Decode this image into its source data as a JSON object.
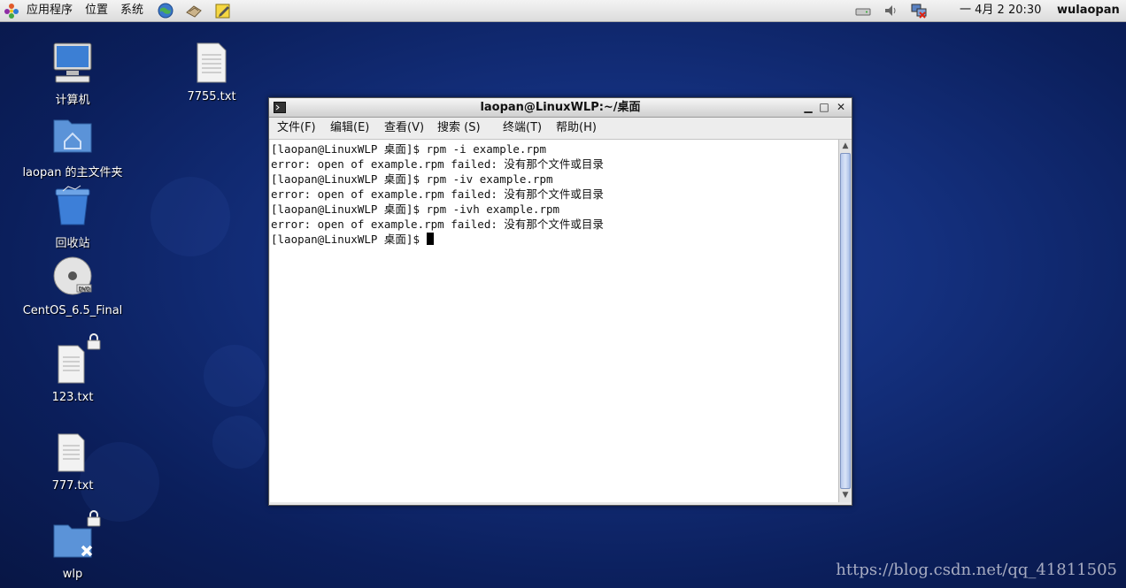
{
  "top_panel": {
    "menu": [
      "应用程序",
      "位置",
      "系统"
    ],
    "clock": "一 4月  2 20:30",
    "user": "wulaopan"
  },
  "desktop": {
    "icons": [
      {
        "label": "计算机",
        "icon": "computer-icon"
      },
      {
        "label": "7755.txt",
        "icon": "text-file-icon"
      },
      {
        "label": "laopan 的主文件夹",
        "icon": "home-folder-icon"
      },
      {
        "label": "回收站",
        "icon": "trash-icon"
      },
      {
        "label": "CentOS_6.5_Final",
        "icon": "dvd-icon"
      },
      {
        "label": "123.txt",
        "icon": "locked-text-file-icon"
      },
      {
        "label": "777.txt",
        "icon": "text-file-icon"
      },
      {
        "label": "wlp",
        "icon": "locked-folder-icon"
      }
    ]
  },
  "terminal": {
    "title": "laopan@LinuxWLP:~/桌面",
    "menu": [
      "文件(F)",
      "编辑(E)",
      "查看(V)",
      "搜索 (S)",
      "终端(T)",
      "帮助(H)"
    ],
    "lines": [
      "[laopan@LinuxWLP 桌面]$ rpm -i example.rpm",
      "error: open of example.rpm failed: 没有那个文件或目录",
      "[laopan@LinuxWLP 桌面]$ rpm -iv example.rpm",
      "error: open of example.rpm failed: 没有那个文件或目录",
      "[laopan@LinuxWLP 桌面]$ rpm -ivh example.rpm",
      "error: open of example.rpm failed: 没有那个文件或目录",
      "[laopan@LinuxWLP 桌面]$ "
    ]
  },
  "watermark": "https://blog.csdn.net/qq_41811505",
  "colors": {
    "desktop_bg": "#14307e",
    "accent": "#2f67c9"
  }
}
